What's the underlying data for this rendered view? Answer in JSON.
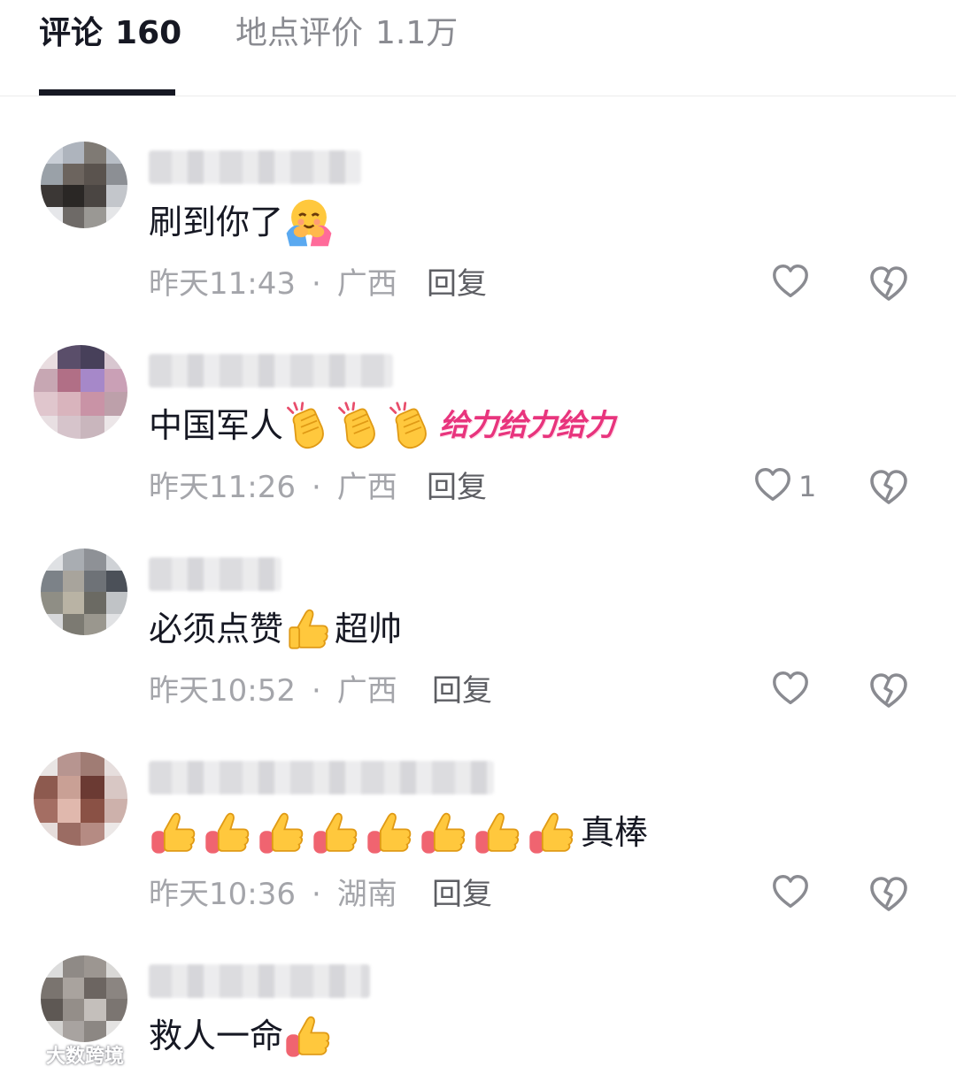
{
  "tabs": [
    {
      "label": "评论",
      "count": "160"
    },
    {
      "label": "地点评价",
      "count": "1.1万"
    }
  ],
  "comments": [
    {
      "text": "刷到你了",
      "emojis": [
        "hug-emoji"
      ],
      "time": "昨天11:43",
      "location": "广西",
      "reply": "回复",
      "like_count": "",
      "avatar_colors": [
        "#c9ced6",
        "#aeb4bd",
        "#7f7a74",
        "#b8bec6",
        "#9aa1a8",
        "#6c645e",
        "#5a534e",
        "#8c8f94",
        "#3b3735",
        "#2a2725",
        "#4a4542",
        "#c3c6cb",
        "#e6e7ea",
        "#6e6a67",
        "#9a9894",
        "#e5e6e8"
      ]
    },
    {
      "text": "中国军人",
      "emojis": [
        "clap-emoji",
        "clap-emoji",
        "clap-emoji"
      ],
      "suffix": "给力给力给力",
      "time": "昨天11:26",
      "location": "广西",
      "reply": "回复",
      "like_count": "1",
      "avatar_colors": [
        "#e9dde0",
        "#5a4e6a",
        "#47405a",
        "#d8c7d0",
        "#c7a7b3",
        "#b16f86",
        "#a688c9",
        "#caa0b6",
        "#e0c6cd",
        "#d9b4bd",
        "#c993a6",
        "#bda0aa",
        "#e8dfe2",
        "#d6c4cb",
        "#c9b6bd",
        "#ece6e8"
      ]
    },
    {
      "text": "必须点赞",
      "emojis": [
        "thumbs-up-emoji"
      ],
      "suffix_plain": "超帅",
      "time": "昨天10:52",
      "location": "广西",
      "reply": "回复",
      "like_count": "",
      "avatar_colors": [
        "#dfe1e4",
        "#a9adb2",
        "#8e9196",
        "#cfd2d6",
        "#7c8288",
        "#a8a49c",
        "#6e7277",
        "#4b5058",
        "#8f8e85",
        "#b9b3a4",
        "#6b6a63",
        "#c0c3c6",
        "#d7d8da",
        "#7c7a72",
        "#9a978e",
        "#e1e2e4"
      ]
    },
    {
      "text": "真棒",
      "emojis_before": [
        "thumbs-up-emoji",
        "thumbs-up-emoji",
        "thumbs-up-emoji",
        "thumbs-up-emoji",
        "thumbs-up-emoji",
        "thumbs-up-emoji",
        "thumbs-up-emoji",
        "thumbs-up-emoji"
      ],
      "time": "昨天10:36",
      "location": "湖南",
      "reply": "回复",
      "like_count": "",
      "avatar_colors": [
        "#e9e5e4",
        "#b79590",
        "#a07c74",
        "#e6dedd",
        "#8d5a4f",
        "#c9a095",
        "#6b3a33",
        "#d8c7c4",
        "#a46e63",
        "#e0b8ad",
        "#8a5145",
        "#cdb1ab",
        "#e6dddb",
        "#9b6c63",
        "#b58b83",
        "#ece8e7"
      ]
    },
    {
      "text": "救人一命",
      "emojis": [
        "thumbs-up-emoji"
      ],
      "time": "",
      "location": "",
      "reply": "",
      "like_count": "",
      "avatar_colors": [
        "#dcdcdc",
        "#8f8a86",
        "#9c9691",
        "#d9d8d6",
        "#7a746f",
        "#a9a39e",
        "#6c6561",
        "#8b8581",
        "#5e5854",
        "#948e89",
        "#c4bfbb",
        "#7b7571",
        "#d3d2d0",
        "#a8a3a0",
        "#8c8783",
        "#e4e3e2"
      ]
    }
  ],
  "watermark": "大数跨境",
  "colors": {
    "accent_text": "#161823",
    "meta": "#a4a5aa",
    "reply": "#5d5e63",
    "geili": "#e8347d"
  }
}
